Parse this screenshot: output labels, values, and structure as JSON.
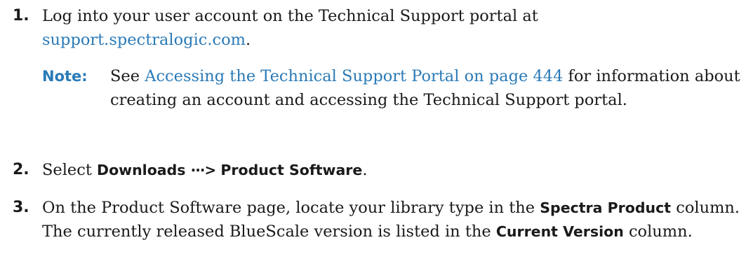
{
  "steps": [
    {
      "number": "1.",
      "text_before": "Log into your user account on the Technical Support portal at ",
      "link": "support.spectralogic.com",
      "text_after": "."
    },
    {
      "number": "2.",
      "text_before": "Select ",
      "bold1": "Downloads",
      "separator": "···>",
      "bold2": "Product Software",
      "text_after": "."
    },
    {
      "number": "3.",
      "text_before": "On the Product Software page, locate your library type in the ",
      "bold1": "Spectra Product",
      "text_mid": " column. The currently released BlueScale version is listed in the ",
      "bold2": "Current Version",
      "text_after": " column."
    }
  ],
  "note": {
    "label": "Note:",
    "text_before": "See ",
    "link": "Accessing the Technical Support Portal on page 444",
    "text_after": " for information about creating an account and accessing the Technical Support portal."
  }
}
